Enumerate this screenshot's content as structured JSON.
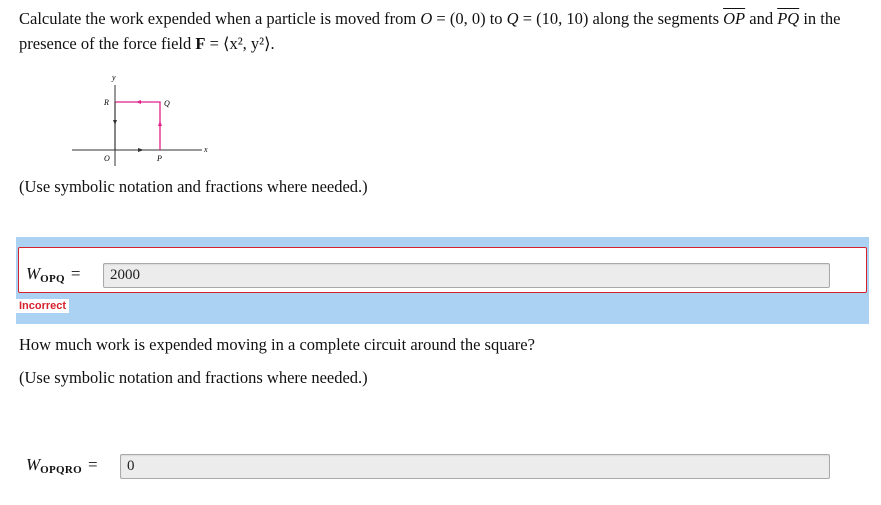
{
  "question1": {
    "text_a": "Calculate the work expended when a particle is moved from ",
    "O": "O",
    "eq1": " = (0, 0) to ",
    "Q": "Q",
    "eq2": " = (10, 10) along the segments ",
    "OP": "OP",
    "and": " and ",
    "PQ": "PQ",
    "text_b": " in the presence of the force field ",
    "F": "F",
    "field": " = ⟨x², y²⟩."
  },
  "figure": {
    "labels": {
      "y": "y",
      "x": "x",
      "R": "R",
      "Q": "Q",
      "O": "O",
      "P": "P"
    },
    "colors": {
      "axis": "#333333",
      "path": "#e0218a"
    }
  },
  "note1": "(Use symbolic notation and fractions where needed.)",
  "answer1": {
    "label_W": "W",
    "label_sub": "OPQ",
    "equals": "=",
    "value": "2000",
    "status": "Incorrect"
  },
  "question2": "How much work is expended moving in a complete circuit around the square?",
  "note2": "(Use symbolic notation and fractions where needed.)",
  "answer2": {
    "label_W": "W",
    "label_sub": "OPQRO",
    "equals": "=",
    "value": "0"
  },
  "colors": {
    "band": "#abd2f3",
    "error": "#d4232d"
  }
}
